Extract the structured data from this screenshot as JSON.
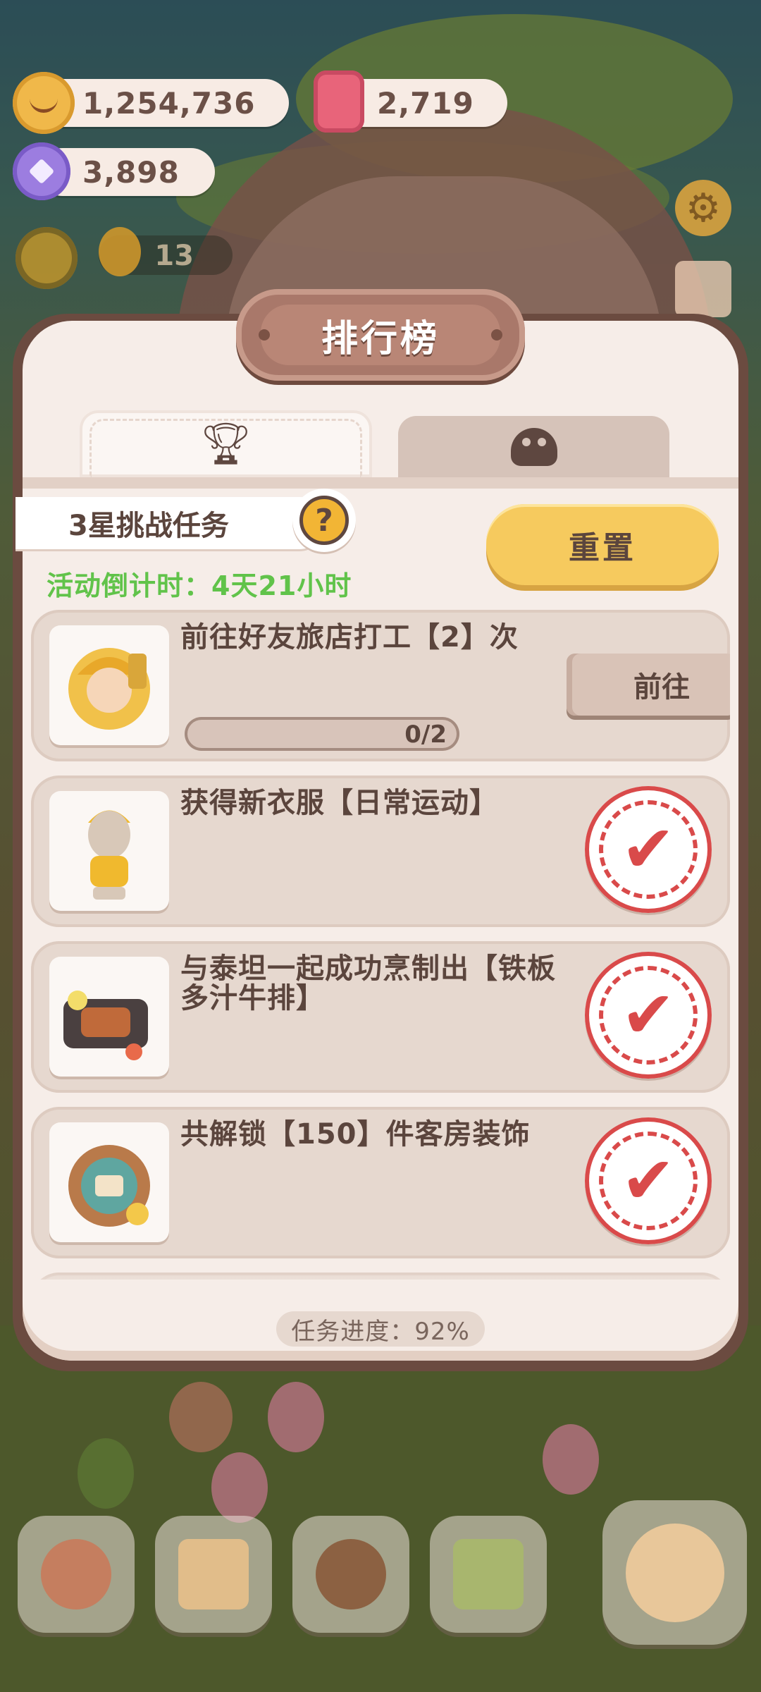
{
  "hud": {
    "cookies": "1,254,736",
    "candles": "2,719",
    "gems": "3,898",
    "level_count": "13"
  },
  "panel": {
    "title": "排行榜",
    "tabs": [
      {
        "icon": "trophy-icon",
        "active": true
      },
      {
        "icon": "cookie-icon",
        "active": false
      }
    ],
    "challenge_label": "3星挑战任务",
    "help_symbol": "?",
    "countdown": "活动倒计时：4天21小时",
    "reset_label": "重置",
    "tasks": [
      {
        "text": "前往好友旅店打工【2】次",
        "progress": "0/2",
        "action_label": "前往",
        "completed": false,
        "icon": "worker-character-icon"
      },
      {
        "text": "获得新衣服【日常运动】",
        "completed": true,
        "icon": "outfit-figure-icon"
      },
      {
        "text": "与泰坦一起成功烹制出【铁板多汁牛排】",
        "completed": true,
        "icon": "steak-plate-icon"
      },
      {
        "text": "共解锁【150】件客房装饰",
        "completed": true,
        "icon": "room-decor-icon"
      }
    ],
    "total_progress": "任务进度：92%"
  },
  "colors": {
    "accent_yellow": "#f6ca5e",
    "countdown_green": "#61c34a",
    "stamp_red": "#d94a4a",
    "panel_bg": "#f6ede8",
    "text_brown": "#5b453d"
  }
}
